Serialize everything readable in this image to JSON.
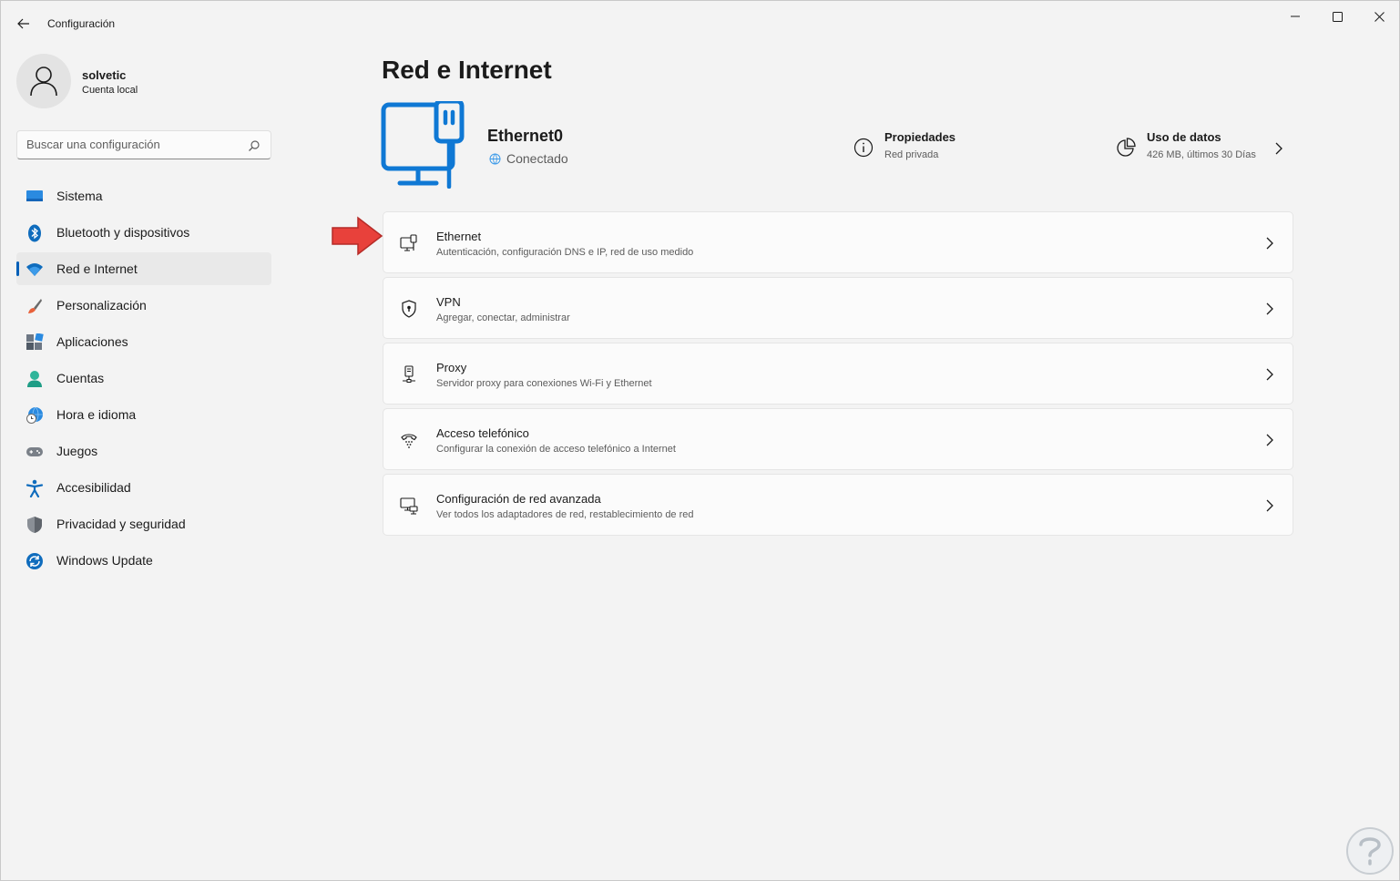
{
  "window": {
    "title": "Configuración"
  },
  "user": {
    "name": "solvetic",
    "account_type": "Cuenta local"
  },
  "search": {
    "placeholder": "Buscar una configuración"
  },
  "sidebar": {
    "items": [
      {
        "label": "Sistema",
        "icon": "system-icon"
      },
      {
        "label": "Bluetooth y dispositivos",
        "icon": "bluetooth-icon"
      },
      {
        "label": "Red e Internet",
        "icon": "wifi-icon",
        "selected": true
      },
      {
        "label": "Personalización",
        "icon": "brush-icon"
      },
      {
        "label": "Aplicaciones",
        "icon": "apps-icon"
      },
      {
        "label": "Cuentas",
        "icon": "accounts-icon"
      },
      {
        "label": "Hora e idioma",
        "icon": "time-language-icon"
      },
      {
        "label": "Juegos",
        "icon": "gamepad-icon"
      },
      {
        "label": "Accesibilidad",
        "icon": "accessibility-icon"
      },
      {
        "label": "Privacidad y seguridad",
        "icon": "shield-icon"
      },
      {
        "label": "Windows Update",
        "icon": "update-icon"
      }
    ]
  },
  "main": {
    "title": "Red e Internet",
    "device": {
      "name": "Ethernet0",
      "status": "Conectado"
    },
    "properties": {
      "title": "Propiedades",
      "subtitle": "Red privada"
    },
    "data_usage": {
      "title": "Uso de datos",
      "subtitle": "426 MB, últimos 30 Días"
    },
    "cards": [
      {
        "title": "Ethernet",
        "subtitle": "Autenticación, configuración DNS e IP, red de uso medido",
        "icon": "ethernet-icon"
      },
      {
        "title": "VPN",
        "subtitle": "Agregar, conectar, administrar",
        "icon": "vpn-shield-icon"
      },
      {
        "title": "Proxy",
        "subtitle": "Servidor proxy para conexiones Wi-Fi y Ethernet",
        "icon": "proxy-icon"
      },
      {
        "title": "Acceso telefónico",
        "subtitle": "Configurar la conexión de acceso telefónico a Internet",
        "icon": "dialup-icon"
      },
      {
        "title": "Configuración de red avanzada",
        "subtitle": "Ver todos los adaptadores de red, restablecimiento de red",
        "icon": "advanced-network-icon"
      }
    ]
  },
  "colors": {
    "accent": "#005fb8",
    "hero_blue": "#0f78d4",
    "annotation_arrow": "#e8413b"
  }
}
